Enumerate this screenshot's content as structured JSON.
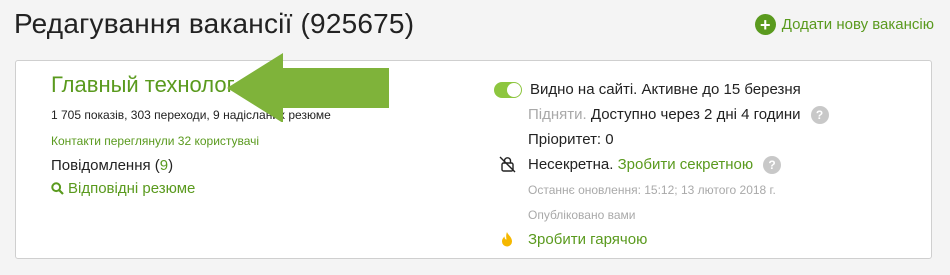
{
  "header": {
    "title": "Редагування вакансії (925675)",
    "add_vacancy_label": "Додати нову вакансію"
  },
  "vacancy": {
    "title": "Главный технолог",
    "stats": "1 705 показів, 303 переходи, 9 надісланих резюме",
    "contacts_viewed": "Контакти переглянули 32 користувачі",
    "messages_label": "Повідомлення",
    "messages_count": "9",
    "matching_resumes": "Відповідні резюме"
  },
  "status": {
    "visibility": "Видно на сайті. Активне до 15 березня",
    "raise_label": "Підняти.",
    "raise_available": "Доступно через 2 дні 4 години",
    "priority": "Пріоритет: 0",
    "secrecy_status": "Несекретна.",
    "make_secret": "Зробити секретною",
    "last_update": "Останнє оновлення: 15:12; 13 лютого 2018 г.",
    "published_by": "Опубліковано вами",
    "make_hot": "Зробити гарячою"
  },
  "colors": {
    "accent_green": "#5a9a1e",
    "arrow_green": "#7fb33a",
    "toggle_green": "#8dc63f"
  },
  "icons": [
    "plus-circle-icon",
    "external-link-icon",
    "search-icon",
    "toggle-switch",
    "help-icon",
    "unlocked-icon",
    "fire-icon",
    "arrow-pointer"
  ]
}
